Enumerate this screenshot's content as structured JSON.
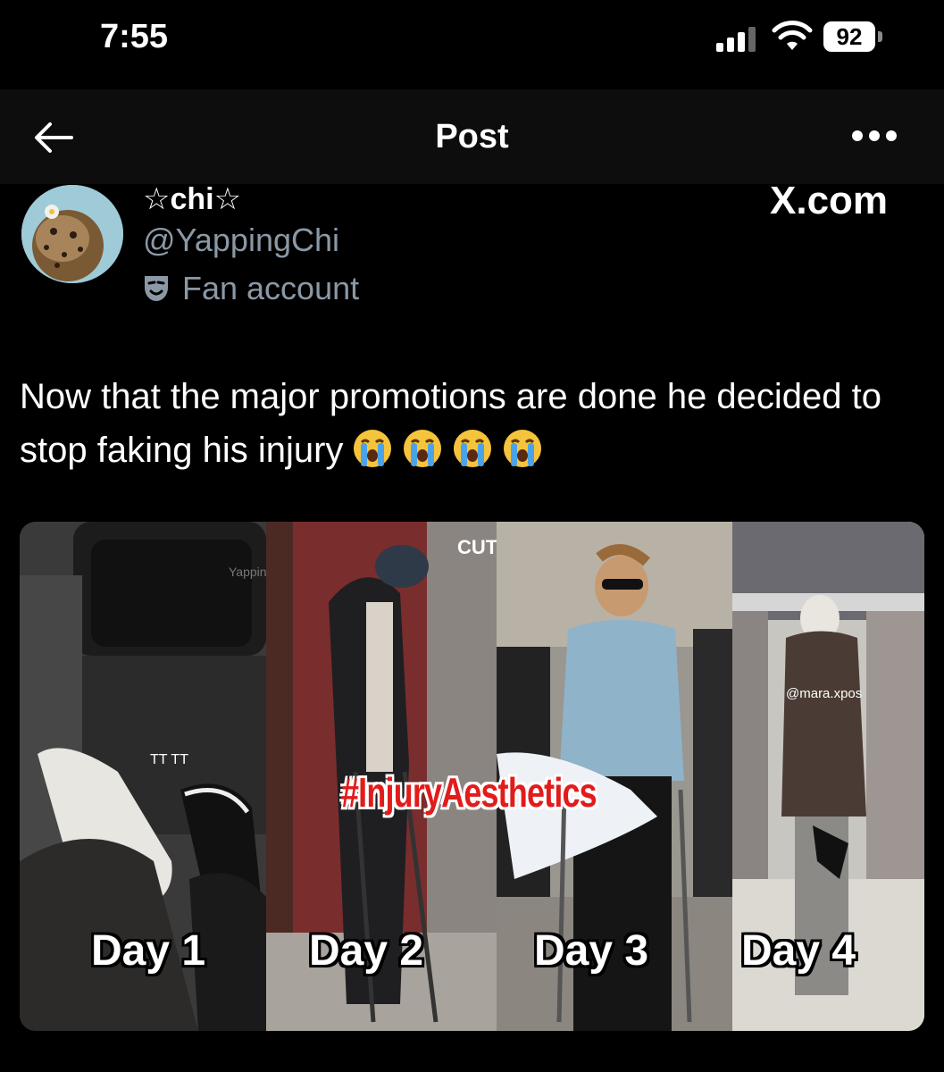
{
  "status_bar": {
    "time": "7:55",
    "battery": "92"
  },
  "header": {
    "title": "Post"
  },
  "author": {
    "display_name": "☆chi☆",
    "handle": "@YappingChi",
    "badge_label": "Fan account"
  },
  "watermark": "X.com",
  "post": {
    "text": "Now that the major promotions are done he decided to stop faking his injury",
    "emoji_count": 4
  },
  "media": {
    "overlay_hashtag": "#InjuryAesthetics",
    "panel_labels": [
      "Day 1",
      "Day 2",
      "Day 3",
      "Day 4"
    ],
    "small_texts": [
      "TT TT",
      "YappingChi",
      "CUT",
      "@mara.xpos"
    ]
  },
  "colors": {
    "background": "#000000",
    "secondary_text": "#8b98a5",
    "hashtag": "#e21b1b"
  }
}
